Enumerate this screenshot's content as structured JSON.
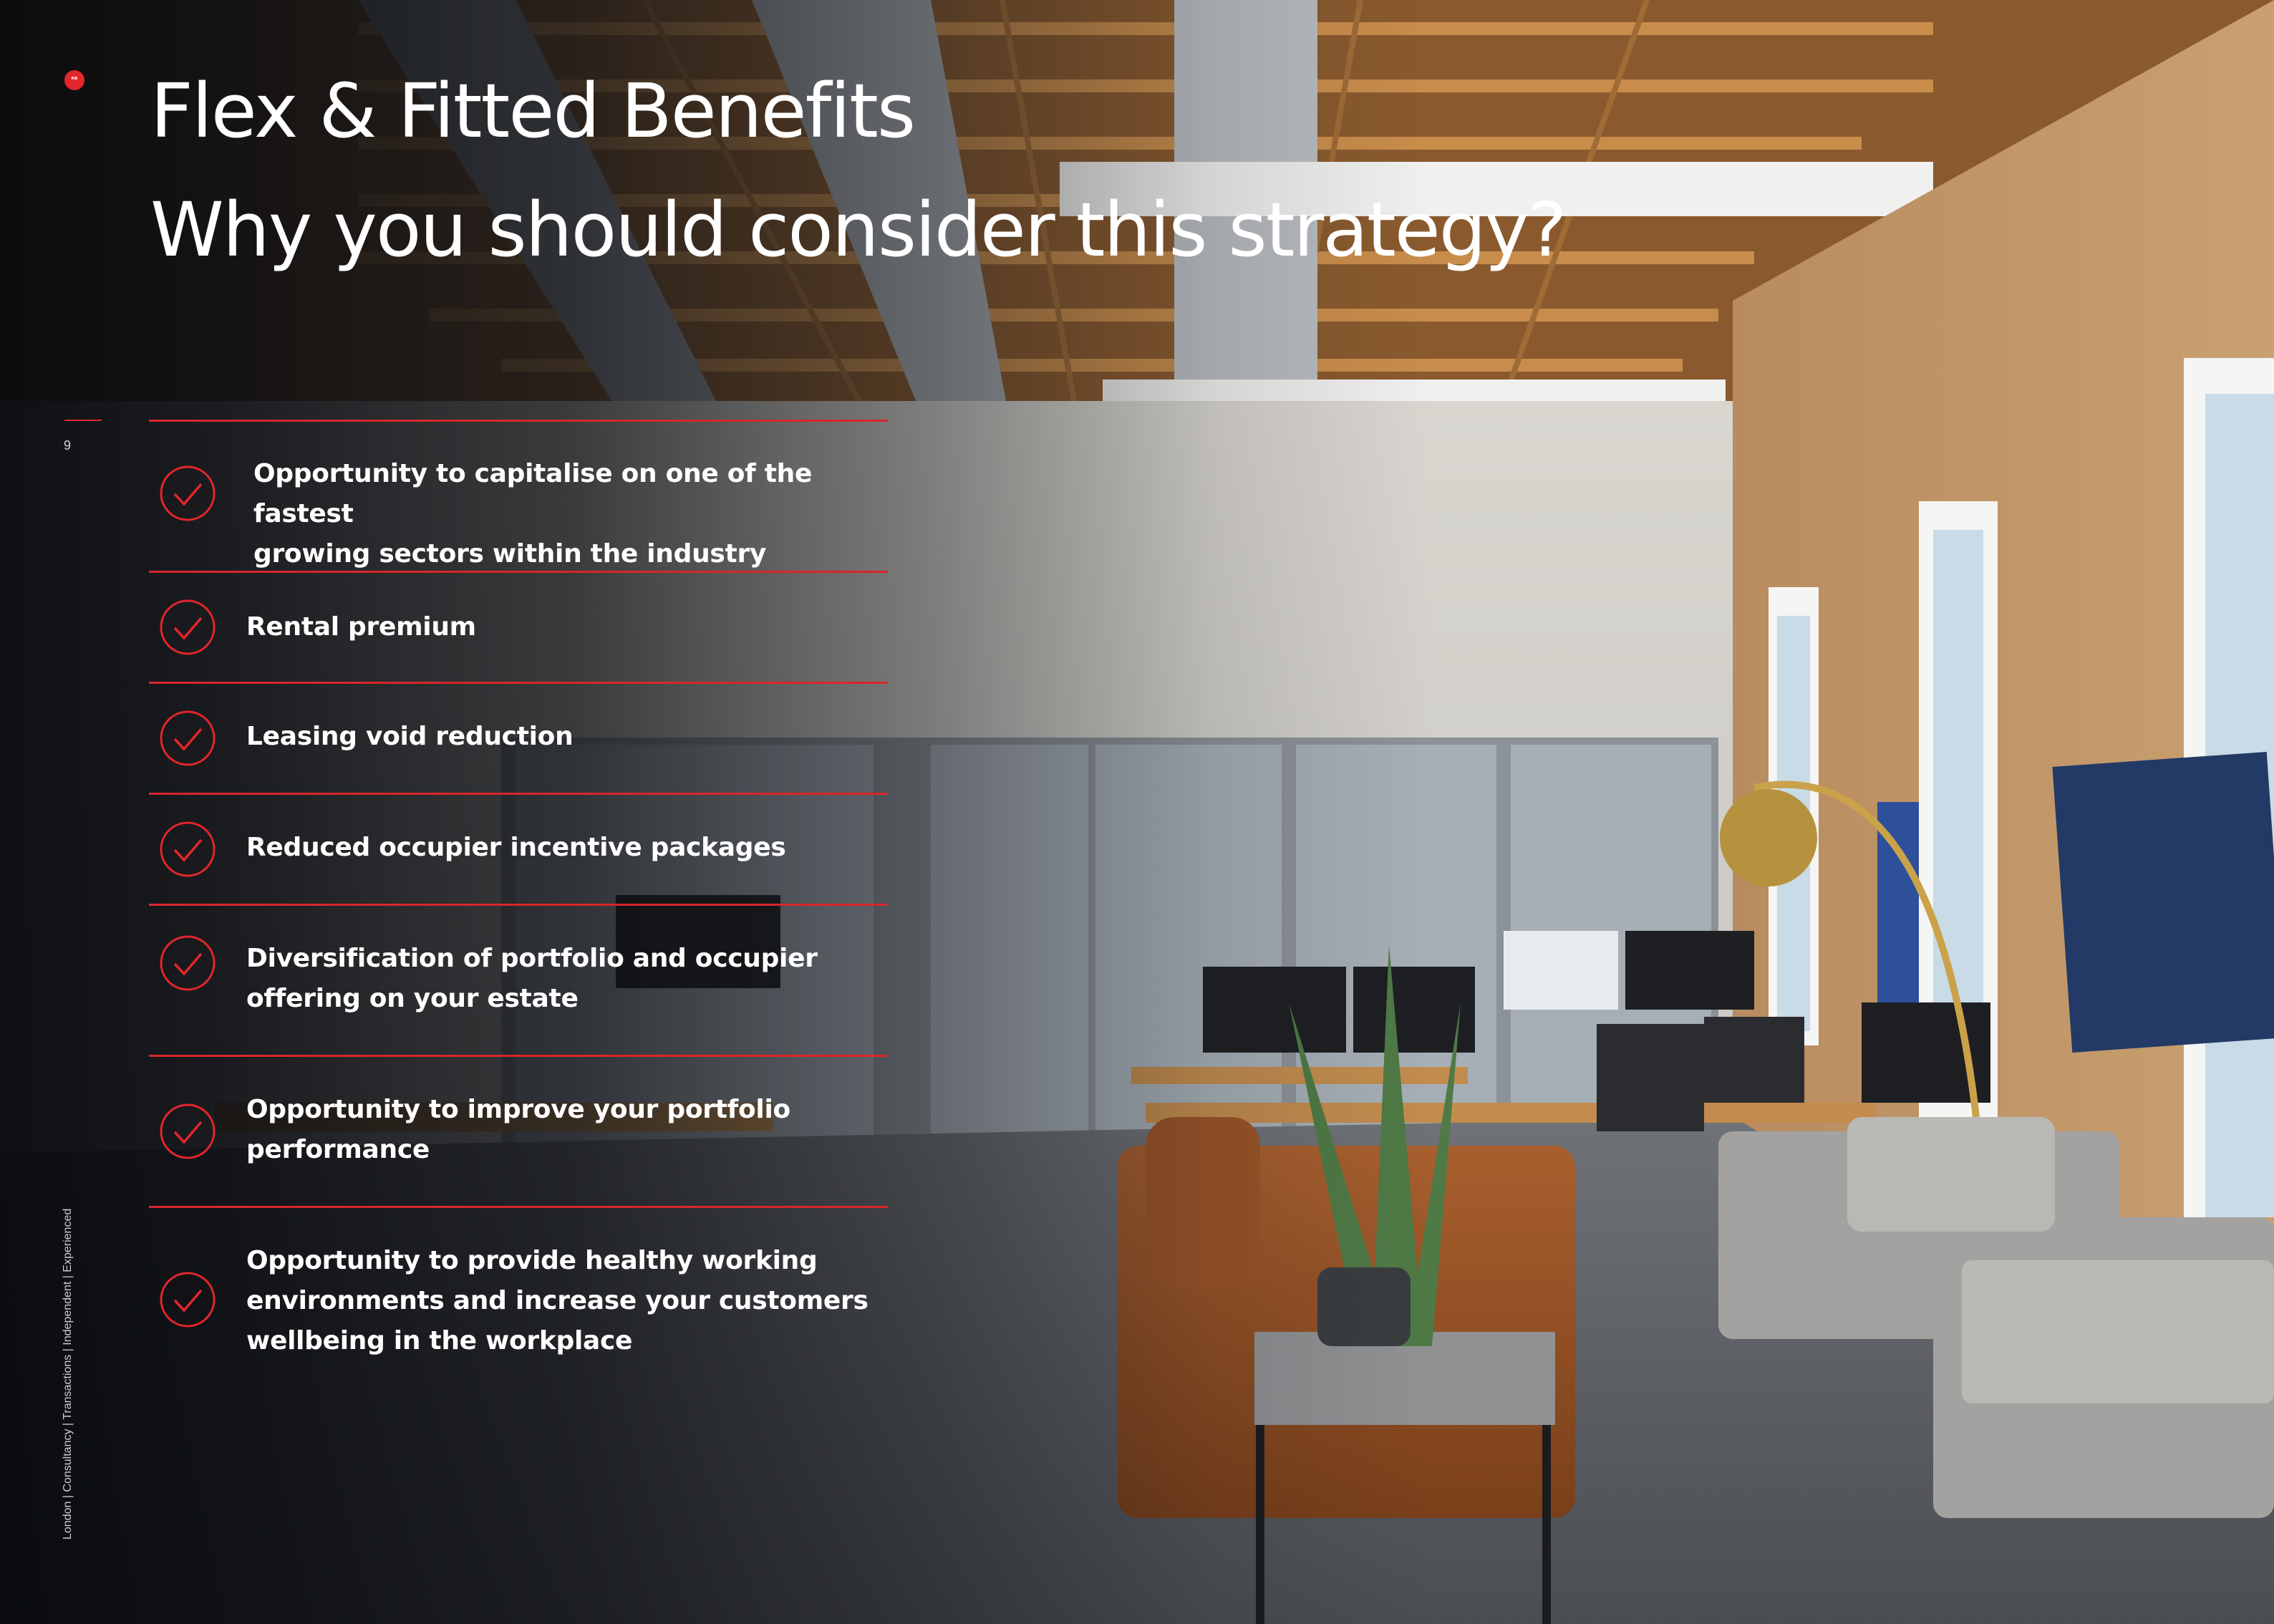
{
  "brand": {
    "logo_text": "ᴿᴮ",
    "accent_color": "#e3262b"
  },
  "header": {
    "title_line1": "Flex & Fitted Benefits",
    "title_line2": "Why you should consider this strategy?"
  },
  "page": {
    "number": "9"
  },
  "sidebar": {
    "tagline": "London | Consultancy | Transactions | Independent | Experienced"
  },
  "benefits": [
    {
      "text_line1": "Opportunity to capitalise on one of the fastest",
      "text_line2": "growing sectors within the industry",
      "icon": "check-circle-icon"
    },
    {
      "text_line1": "Rental premium",
      "icon": "check-circle-icon"
    },
    {
      "text_line1": "Leasing void reduction",
      "icon": "check-circle-icon"
    },
    {
      "text_line1": "Reduced occupier incentive packages",
      "icon": "check-circle-icon"
    },
    {
      "text_line1": "Diversification of portfolio and occupier",
      "text_line2": "offering on your estate",
      "icon": "check-circle-icon"
    },
    {
      "text_line1": "Opportunity to improve your portfolio",
      "text_line2": "performance",
      "icon": "check-circle-icon"
    },
    {
      "text_line1": "Opportunity to provide healthy working",
      "text_line2": "environments and increase your customers",
      "text_line3": "wellbeing in the workplace",
      "icon": "check-circle-icon"
    }
  ]
}
